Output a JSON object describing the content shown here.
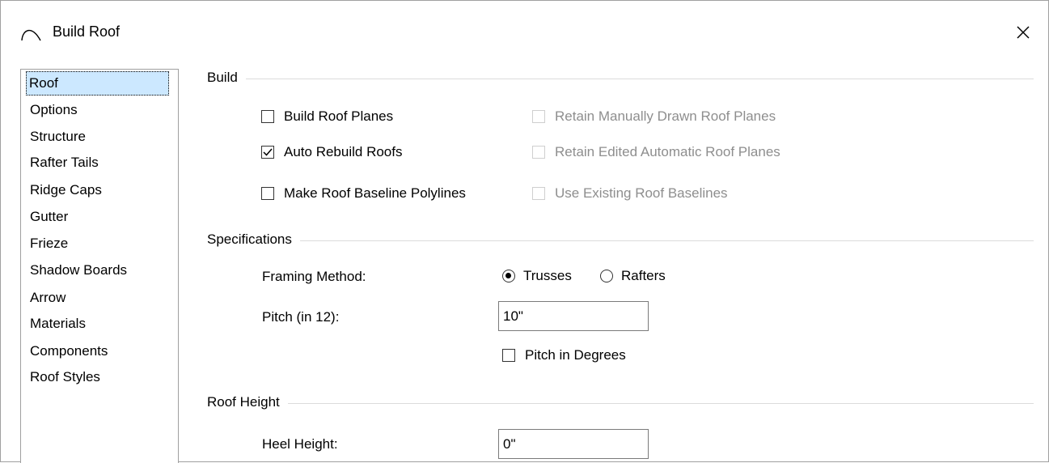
{
  "window": {
    "title": "Build Roof"
  },
  "nav": {
    "items": [
      "Roof",
      "Options",
      "Structure",
      "Rafter Tails",
      "Ridge Caps",
      "Gutter",
      "Frieze",
      "Shadow Boards",
      "Arrow",
      "Materials",
      "Components",
      "Roof Styles"
    ],
    "selected": "Roof"
  },
  "build": {
    "heading": "Build",
    "build_roof_planes": {
      "label": "Build Roof Planes",
      "checked": false
    },
    "auto_rebuild_roofs": {
      "label": "Auto Rebuild Roofs",
      "checked": true
    },
    "make_baseline_polylines": {
      "label": "Make Roof Baseline Polylines",
      "checked": false
    },
    "retain_manual": {
      "label": "Retain Manually Drawn Roof Planes",
      "checked": false,
      "disabled": true
    },
    "retain_edited": {
      "label": "Retain Edited Automatic Roof Planes",
      "checked": false,
      "disabled": true
    },
    "use_existing": {
      "label": "Use Existing Roof Baselines",
      "checked": false,
      "disabled": true
    }
  },
  "specifications": {
    "heading": "Specifications",
    "framing_label": "Framing Method:",
    "framing_options": {
      "trusses": "Trusses",
      "rafters": "Rafters",
      "selected": "Trusses"
    },
    "pitch_label": "Pitch (in 12):",
    "pitch_value": "10\"",
    "pitch_in_degrees": {
      "label": "Pitch in Degrees",
      "checked": false
    }
  },
  "roof_height": {
    "heading": "Roof Height",
    "heel_label": "Heel Height:",
    "heel_value": "0\""
  }
}
